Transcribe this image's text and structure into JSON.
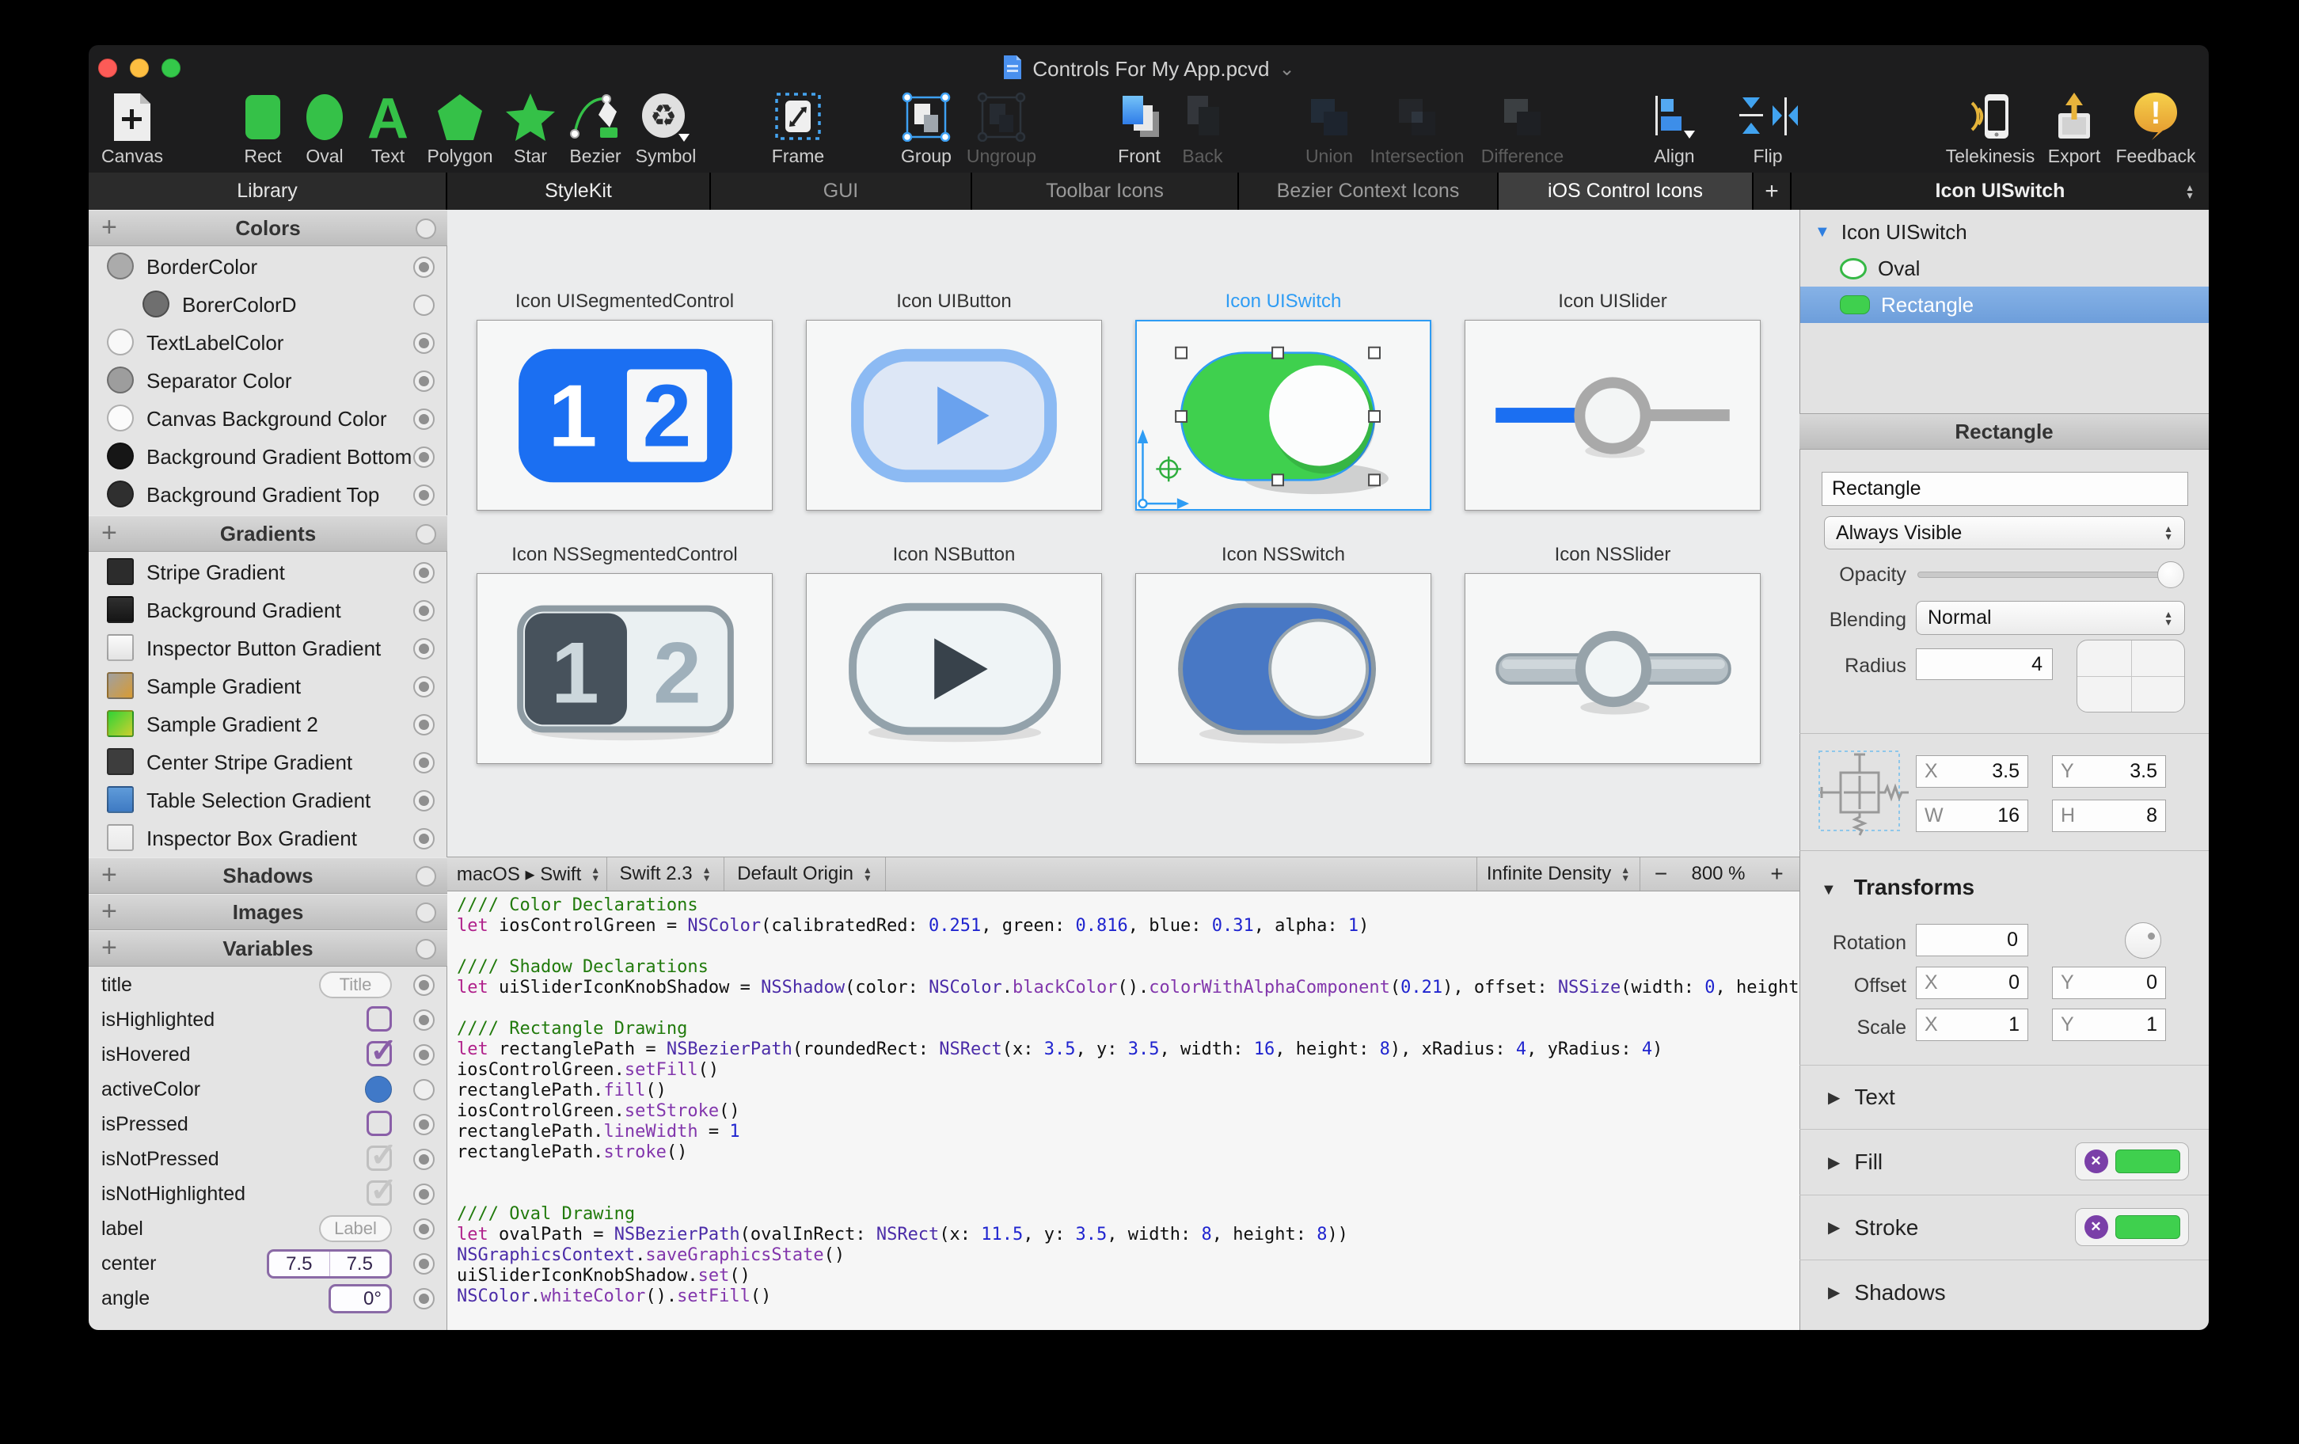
{
  "theme": {
    "accent_blue": "#2e9cf4",
    "ios_green": "#3fd04e",
    "ns_blue": "#4878c5",
    "segmented_blue": "#1b6ff2"
  },
  "titlebar": {
    "title": "Controls For My App.pcvd"
  },
  "toolbar": {
    "items": [
      {
        "id": "canvas",
        "label": "Canvas",
        "disabled": false
      },
      {
        "id": "rect",
        "label": "Rect",
        "disabled": false
      },
      {
        "id": "oval",
        "label": "Oval",
        "disabled": false
      },
      {
        "id": "text",
        "label": "Text",
        "disabled": false
      },
      {
        "id": "polygon",
        "label": "Polygon",
        "disabled": false
      },
      {
        "id": "star",
        "label": "Star",
        "disabled": false
      },
      {
        "id": "bezier",
        "label": "Bezier",
        "disabled": false
      },
      {
        "id": "symbol",
        "label": "Symbol",
        "disabled": false
      },
      {
        "id": "frame",
        "label": "Frame",
        "disabled": false
      },
      {
        "id": "group",
        "label": "Group",
        "disabled": false
      },
      {
        "id": "ungroup",
        "label": "Ungroup",
        "disabled": true
      },
      {
        "id": "front",
        "label": "Front",
        "disabled": false
      },
      {
        "id": "back",
        "label": "Back",
        "disabled": true
      },
      {
        "id": "union",
        "label": "Union",
        "disabled": true
      },
      {
        "id": "intersection",
        "label": "Intersection",
        "disabled": true
      },
      {
        "id": "difference",
        "label": "Difference",
        "disabled": true
      },
      {
        "id": "align",
        "label": "Align",
        "disabled": false
      },
      {
        "id": "flip",
        "label": "Flip",
        "disabled": false
      },
      {
        "id": "telekinesis",
        "label": "Telekinesis",
        "disabled": false
      },
      {
        "id": "export",
        "label": "Export",
        "disabled": false
      },
      {
        "id": "feedback",
        "label": "Feedback",
        "disabled": false
      }
    ]
  },
  "tabs": {
    "items": [
      {
        "id": "library",
        "label": "Library",
        "state": "lib"
      },
      {
        "id": "stylekit",
        "label": "StyleKit",
        "state": "bright"
      },
      {
        "id": "gui",
        "label": "GUI",
        "state": "dim"
      },
      {
        "id": "toolbar-icons",
        "label": "Toolbar Icons",
        "state": "dim"
      },
      {
        "id": "bezier-context-icons",
        "label": "Bezier Context Icons",
        "state": "dim"
      },
      {
        "id": "ios-control-icons",
        "label": "iOS Control Icons",
        "state": "active"
      },
      {
        "id": "add-tab",
        "label": "+",
        "state": "plus"
      }
    ],
    "panel_header": "Icon UISwitch"
  },
  "sidebar": {
    "colors": {
      "title": "Colors",
      "items": [
        {
          "name": "BorderColor",
          "swatch": "#ababab",
          "indent": 0,
          "target": "dot"
        },
        {
          "name": "BorerColorD",
          "swatch": "#6f6f6f",
          "indent": 1,
          "target": "plain"
        },
        {
          "name": "TextLabelColor",
          "swatch": "#f8f8f8",
          "indent": 0,
          "target": "dot"
        },
        {
          "name": "Separator Color",
          "swatch": "#9d9d9d",
          "indent": 0,
          "target": "dot"
        },
        {
          "name": "Canvas Background Color",
          "swatch": "#fbfbfb",
          "indent": 0,
          "target": "dot"
        },
        {
          "name": "Background Gradient Bottom",
          "swatch": "#161616",
          "indent": 0,
          "target": "dot"
        },
        {
          "name": "Background Gradient Top",
          "swatch": "#2f2f2f",
          "indent": 0,
          "target": "dot"
        }
      ]
    },
    "gradients": {
      "title": "Gradients",
      "items": [
        {
          "name": "Stripe Gradient",
          "swatch": "#2c2c2c"
        },
        {
          "name": "Background Gradient",
          "swatch": "linear-gradient(180deg,#2f2f2f,#151515)"
        },
        {
          "name": "Inspector Button Gradient",
          "swatch": "linear-gradient(180deg,#fbfbfb,#e3e3e3)"
        },
        {
          "name": "Sample Gradient",
          "swatch": "linear-gradient(135deg,#a0a0a0,#d89b33)"
        },
        {
          "name": "Sample Gradient 2",
          "swatch": "linear-gradient(135deg,#31d336,#ccd02f)"
        },
        {
          "name": "Center Stripe Gradient",
          "swatch": "#3d3d3d"
        },
        {
          "name": "Table Selection Gradient",
          "swatch": "linear-gradient(180deg,#5f9bd9,#3e7ac3)"
        },
        {
          "name": "Inspector Box Gradient",
          "swatch": "linear-gradient(180deg,#f4f4f4,#e9e9e9)"
        }
      ]
    },
    "shadows": {
      "title": "Shadows"
    },
    "images": {
      "title": "Images"
    },
    "variables": {
      "title": "Variables",
      "items": [
        {
          "name": "title",
          "control": "pill",
          "value": "Title",
          "target": "dot"
        },
        {
          "name": "isHighlighted",
          "control": "checkbox",
          "checked": false,
          "tone": "purple",
          "target": "dot"
        },
        {
          "name": "isHovered",
          "control": "checkbox",
          "checked": true,
          "tone": "purple",
          "target": "dot"
        },
        {
          "name": "activeColor",
          "control": "color",
          "value": "#4079c8",
          "target": "plain"
        },
        {
          "name": "isPressed",
          "control": "checkbox",
          "checked": false,
          "tone": "purple",
          "target": "dot"
        },
        {
          "name": "isNotPressed",
          "control": "checkbox",
          "checked": true,
          "tone": "gray",
          "target": "dot"
        },
        {
          "name": "isNotHighlighted",
          "control": "checkbox",
          "checked": true,
          "tone": "gray",
          "target": "dot"
        },
        {
          "name": "label",
          "control": "pill",
          "value": "Label",
          "target": "dot"
        },
        {
          "name": "center",
          "control": "dual",
          "values": [
            "7.5",
            "7.5"
          ],
          "target": "dot"
        },
        {
          "name": "angle",
          "control": "field",
          "value": "0°",
          "target": "dot"
        }
      ]
    }
  },
  "canvas": {
    "artboards": [
      {
        "id": "ui-segmented",
        "label": "Icon UISegmentedControl",
        "selected": false
      },
      {
        "id": "ui-button",
        "label": "Icon UIButton",
        "selected": false
      },
      {
        "id": "ui-switch",
        "label": "Icon UISwitch",
        "selected": true
      },
      {
        "id": "ui-slider",
        "label": "Icon UISlider",
        "selected": false
      },
      {
        "id": "ns-segmented",
        "label": "Icon NSSegmentedControl",
        "selected": false
      },
      {
        "id": "ns-button",
        "label": "Icon NSButton",
        "selected": false
      },
      {
        "id": "ns-switch",
        "label": "Icon NSSwitch",
        "selected": false
      },
      {
        "id": "ns-slider",
        "label": "Icon NSSlider",
        "selected": false
      }
    ]
  },
  "code": {
    "toolbar": {
      "platform": "macOS ▸ Swift",
      "version": "Swift 2.3",
      "origin": "Default Origin",
      "density": "Infinite Density",
      "zoom_out": "−",
      "zoom_level": "800 %",
      "zoom_in": "+"
    },
    "lines": [
      [
        [
          "c",
          "//// Color Declarations"
        ]
      ],
      [
        [
          "k",
          "let "
        ],
        [
          "v",
          "iosControlGreen = "
        ],
        [
          "t",
          "NSColor"
        ],
        [
          "v",
          "(calibratedRed: "
        ],
        [
          "n",
          "0.251"
        ],
        [
          "v",
          ", green: "
        ],
        [
          "n",
          "0.816"
        ],
        [
          "v",
          ", blue: "
        ],
        [
          "n",
          "0.31"
        ],
        [
          "v",
          ", alpha: "
        ],
        [
          "n",
          "1"
        ],
        [
          "v",
          ")"
        ]
      ],
      [],
      [
        [
          "c",
          "//// Shadow Declarations"
        ]
      ],
      [
        [
          "k",
          "let "
        ],
        [
          "v",
          "uiSliderIconKnobShadow = "
        ],
        [
          "t",
          "NSShadow"
        ],
        [
          "v",
          "(color: "
        ],
        [
          "t",
          "NSColor"
        ],
        [
          "v",
          "."
        ],
        [
          "m",
          "blackColor"
        ],
        [
          "v",
          "()."
        ],
        [
          "m",
          "colorWithAlphaComponent"
        ],
        [
          "v",
          "("
        ],
        [
          "n",
          "0.21"
        ],
        [
          "v",
          "), offset: "
        ],
        [
          "t",
          "NSSize"
        ],
        [
          "v",
          "(width: "
        ],
        [
          "n",
          "0"
        ],
        [
          "v",
          ", height"
        ]
      ],
      [],
      [
        [
          "c",
          "//// Rectangle Drawing"
        ]
      ],
      [
        [
          "k",
          "let "
        ],
        [
          "v",
          "rectanglePath = "
        ],
        [
          "t",
          "NSBezierPath"
        ],
        [
          "v",
          "(roundedRect: "
        ],
        [
          "t",
          "NSRect"
        ],
        [
          "v",
          "(x: "
        ],
        [
          "n",
          "3.5"
        ],
        [
          "v",
          ", y: "
        ],
        [
          "n",
          "3.5"
        ],
        [
          "v",
          ", width: "
        ],
        [
          "n",
          "16"
        ],
        [
          "v",
          ", height: "
        ],
        [
          "n",
          "8"
        ],
        [
          "v",
          "), xRadius: "
        ],
        [
          "n",
          "4"
        ],
        [
          "v",
          ", yRadius: "
        ],
        [
          "n",
          "4"
        ],
        [
          "v",
          ")"
        ]
      ],
      [
        [
          "v",
          "iosControlGreen."
        ],
        [
          "m",
          "setFill"
        ],
        [
          "v",
          "()"
        ]
      ],
      [
        [
          "v",
          "rectanglePath."
        ],
        [
          "m",
          "fill"
        ],
        [
          "v",
          "()"
        ]
      ],
      [
        [
          "v",
          "iosControlGreen."
        ],
        [
          "m",
          "setStroke"
        ],
        [
          "v",
          "()"
        ]
      ],
      [
        [
          "v",
          "rectanglePath."
        ],
        [
          "m",
          "lineWidth"
        ],
        [
          "v",
          " = "
        ],
        [
          "n",
          "1"
        ]
      ],
      [
        [
          "v",
          "rectanglePath."
        ],
        [
          "m",
          "stroke"
        ],
        [
          "v",
          "()"
        ]
      ],
      [],
      [],
      [
        [
          "c",
          "//// Oval Drawing"
        ]
      ],
      [
        [
          "k",
          "let "
        ],
        [
          "v",
          "ovalPath = "
        ],
        [
          "t",
          "NSBezierPath"
        ],
        [
          "v",
          "(ovalInRect: "
        ],
        [
          "t",
          "NSRect"
        ],
        [
          "v",
          "(x: "
        ],
        [
          "n",
          "11.5"
        ],
        [
          "v",
          ", y: "
        ],
        [
          "n",
          "3.5"
        ],
        [
          "v",
          ", width: "
        ],
        [
          "n",
          "8"
        ],
        [
          "v",
          ", height: "
        ],
        [
          "n",
          "8"
        ],
        [
          "v",
          "))"
        ]
      ],
      [
        [
          "t",
          "NSGraphicsContext"
        ],
        [
          "v",
          "."
        ],
        [
          "m",
          "saveGraphicsState"
        ],
        [
          "v",
          "()"
        ]
      ],
      [
        [
          "v",
          "uiSliderIconKnobShadow."
        ],
        [
          "m",
          "set"
        ],
        [
          "v",
          "()"
        ]
      ],
      [
        [
          "t",
          "NSColor"
        ],
        [
          "v",
          "."
        ],
        [
          "m",
          "whiteColor"
        ],
        [
          "v",
          "()."
        ],
        [
          "m",
          "setFill"
        ],
        [
          "v",
          "()"
        ]
      ]
    ]
  },
  "inspector": {
    "layers": {
      "root": "Icon UISwitch",
      "children": [
        {
          "name": "Oval",
          "selected": false
        },
        {
          "name": "Rectangle",
          "selected": true
        }
      ]
    },
    "section_title": "Rectangle",
    "name_value": "Rectangle",
    "visibility": "Always Visible",
    "opacity_label": "Opacity",
    "blending_label": "Blending",
    "blending_value": "Normal",
    "radius_label": "Radius",
    "radius_value": "4",
    "frame": {
      "x_label": "X",
      "x": "3.5",
      "y_label": "Y",
      "y": "3.5",
      "w_label": "W",
      "w": "16",
      "h_label": "H",
      "h": "8"
    },
    "transforms": {
      "title": "Transforms",
      "rotation_label": "Rotation",
      "rotation": "0",
      "offset_label": "Offset",
      "offset_x_label": "X",
      "offset_x": "0",
      "offset_y_label": "Y",
      "offset_y": "0",
      "scale_label": "Scale",
      "scale_x_label": "X",
      "scale_x": "1",
      "scale_y_label": "Y",
      "scale_y": "1"
    },
    "sections": [
      {
        "label": "Text",
        "swatch": false
      },
      {
        "label": "Fill",
        "swatch": true
      },
      {
        "label": "Stroke",
        "swatch": true
      },
      {
        "label": "Shadows",
        "swatch": false
      }
    ]
  }
}
